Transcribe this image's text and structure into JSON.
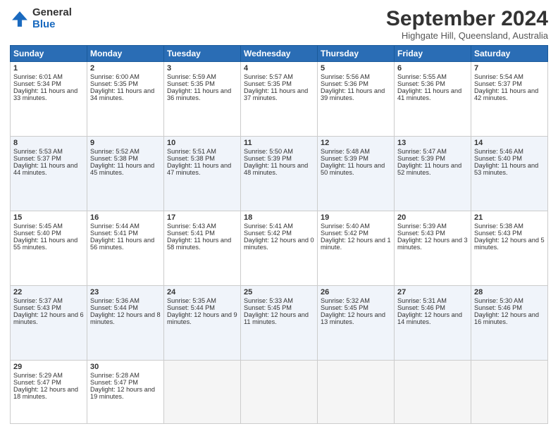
{
  "logo": {
    "general": "General",
    "blue": "Blue"
  },
  "title": "September 2024",
  "location": "Highgate Hill, Queensland, Australia",
  "weekdays": [
    "Sunday",
    "Monday",
    "Tuesday",
    "Wednesday",
    "Thursday",
    "Friday",
    "Saturday"
  ],
  "rows": [
    [
      {
        "day": "1",
        "sunrise": "6:01 AM",
        "sunset": "5:34 PM",
        "daylight": "11 hours and 33 minutes."
      },
      {
        "day": "2",
        "sunrise": "6:00 AM",
        "sunset": "5:35 PM",
        "daylight": "11 hours and 34 minutes."
      },
      {
        "day": "3",
        "sunrise": "5:59 AM",
        "sunset": "5:35 PM",
        "daylight": "11 hours and 36 minutes."
      },
      {
        "day": "4",
        "sunrise": "5:57 AM",
        "sunset": "5:35 PM",
        "daylight": "11 hours and 37 minutes."
      },
      {
        "day": "5",
        "sunrise": "5:56 AM",
        "sunset": "5:36 PM",
        "daylight": "11 hours and 39 minutes."
      },
      {
        "day": "6",
        "sunrise": "5:55 AM",
        "sunset": "5:36 PM",
        "daylight": "11 hours and 41 minutes."
      },
      {
        "day": "7",
        "sunrise": "5:54 AM",
        "sunset": "5:37 PM",
        "daylight": "11 hours and 42 minutes."
      }
    ],
    [
      {
        "day": "8",
        "sunrise": "5:53 AM",
        "sunset": "5:37 PM",
        "daylight": "11 hours and 44 minutes."
      },
      {
        "day": "9",
        "sunrise": "5:52 AM",
        "sunset": "5:38 PM",
        "daylight": "11 hours and 45 minutes."
      },
      {
        "day": "10",
        "sunrise": "5:51 AM",
        "sunset": "5:38 PM",
        "daylight": "11 hours and 47 minutes."
      },
      {
        "day": "11",
        "sunrise": "5:50 AM",
        "sunset": "5:39 PM",
        "daylight": "11 hours and 48 minutes."
      },
      {
        "day": "12",
        "sunrise": "5:48 AM",
        "sunset": "5:39 PM",
        "daylight": "11 hours and 50 minutes."
      },
      {
        "day": "13",
        "sunrise": "5:47 AM",
        "sunset": "5:39 PM",
        "daylight": "11 hours and 52 minutes."
      },
      {
        "day": "14",
        "sunrise": "5:46 AM",
        "sunset": "5:40 PM",
        "daylight": "11 hours and 53 minutes."
      }
    ],
    [
      {
        "day": "15",
        "sunrise": "5:45 AM",
        "sunset": "5:40 PM",
        "daylight": "11 hours and 55 minutes."
      },
      {
        "day": "16",
        "sunrise": "5:44 AM",
        "sunset": "5:41 PM",
        "daylight": "11 hours and 56 minutes."
      },
      {
        "day": "17",
        "sunrise": "5:43 AM",
        "sunset": "5:41 PM",
        "daylight": "11 hours and 58 minutes."
      },
      {
        "day": "18",
        "sunrise": "5:41 AM",
        "sunset": "5:42 PM",
        "daylight": "12 hours and 0 minutes."
      },
      {
        "day": "19",
        "sunrise": "5:40 AM",
        "sunset": "5:42 PM",
        "daylight": "12 hours and 1 minute."
      },
      {
        "day": "20",
        "sunrise": "5:39 AM",
        "sunset": "5:43 PM",
        "daylight": "12 hours and 3 minutes."
      },
      {
        "day": "21",
        "sunrise": "5:38 AM",
        "sunset": "5:43 PM",
        "daylight": "12 hours and 5 minutes."
      }
    ],
    [
      {
        "day": "22",
        "sunrise": "5:37 AM",
        "sunset": "5:43 PM",
        "daylight": "12 hours and 6 minutes."
      },
      {
        "day": "23",
        "sunrise": "5:36 AM",
        "sunset": "5:44 PM",
        "daylight": "12 hours and 8 minutes."
      },
      {
        "day": "24",
        "sunrise": "5:35 AM",
        "sunset": "5:44 PM",
        "daylight": "12 hours and 9 minutes."
      },
      {
        "day": "25",
        "sunrise": "5:33 AM",
        "sunset": "5:45 PM",
        "daylight": "12 hours and 11 minutes."
      },
      {
        "day": "26",
        "sunrise": "5:32 AM",
        "sunset": "5:45 PM",
        "daylight": "12 hours and 13 minutes."
      },
      {
        "day": "27",
        "sunrise": "5:31 AM",
        "sunset": "5:46 PM",
        "daylight": "12 hours and 14 minutes."
      },
      {
        "day": "28",
        "sunrise": "5:30 AM",
        "sunset": "5:46 PM",
        "daylight": "12 hours and 16 minutes."
      }
    ],
    [
      {
        "day": "29",
        "sunrise": "5:29 AM",
        "sunset": "5:47 PM",
        "daylight": "12 hours and 18 minutes."
      },
      {
        "day": "30",
        "sunrise": "5:28 AM",
        "sunset": "5:47 PM",
        "daylight": "12 hours and 19 minutes."
      },
      null,
      null,
      null,
      null,
      null
    ]
  ]
}
